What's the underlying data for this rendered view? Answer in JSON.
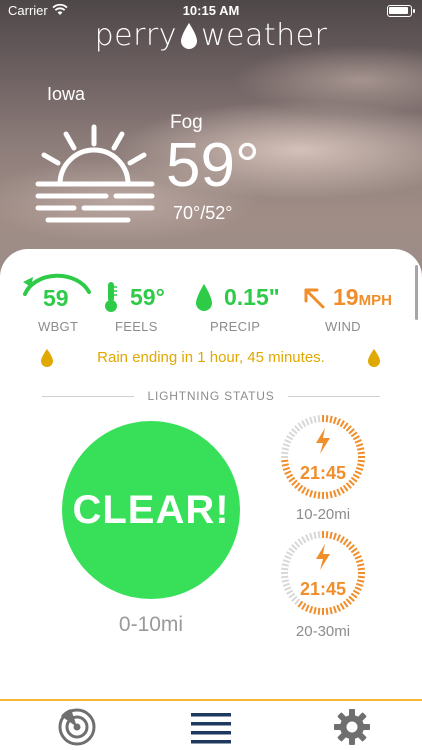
{
  "status_bar": {
    "carrier": "Carrier",
    "time": "10:15 AM"
  },
  "brand": {
    "left": "perry",
    "right": "weather"
  },
  "current": {
    "location": "Iowa",
    "condition": "Fog",
    "temperature": "59°",
    "high_low": "70°/52°",
    "icon": "sunrise-fog-icon"
  },
  "metrics": [
    {
      "key": "wbgt",
      "value": "59",
      "label": "WBGT",
      "color": "#2ecb48",
      "icon": "gauge-icon"
    },
    {
      "key": "feels",
      "value": "59°",
      "label": "FEELS",
      "color": "#2ecb48",
      "icon": "thermometer-icon"
    },
    {
      "key": "precip",
      "value": "0.15\"",
      "label": "PRECIP",
      "color": "#2ecb48",
      "icon": "raindrop-icon"
    },
    {
      "key": "wind",
      "value": "19",
      "unit": "MPH",
      "label": "WIND",
      "color": "#f08e2b",
      "icon": "arrow-northwest-icon"
    }
  ],
  "rain_message": "Rain ending in 1 hour, 45 minutes.",
  "lightning": {
    "section_title": "LIGHTNING STATUS",
    "main": {
      "text": "CLEAR!",
      "range": "0-10mi",
      "color": "#38e05a"
    },
    "timers": [
      {
        "time": "21:45",
        "range": "10-20mi",
        "progress": 0.75,
        "color": "#f08e2b"
      },
      {
        "time": "21:45",
        "range": "20-30mi",
        "progress": 0.62,
        "color": "#f08e2b"
      }
    ]
  },
  "tabbar": {
    "accent": "#f4b633",
    "tabs": [
      {
        "icon": "radar-icon"
      },
      {
        "icon": "menu-icon"
      },
      {
        "icon": "gear-icon"
      }
    ]
  }
}
